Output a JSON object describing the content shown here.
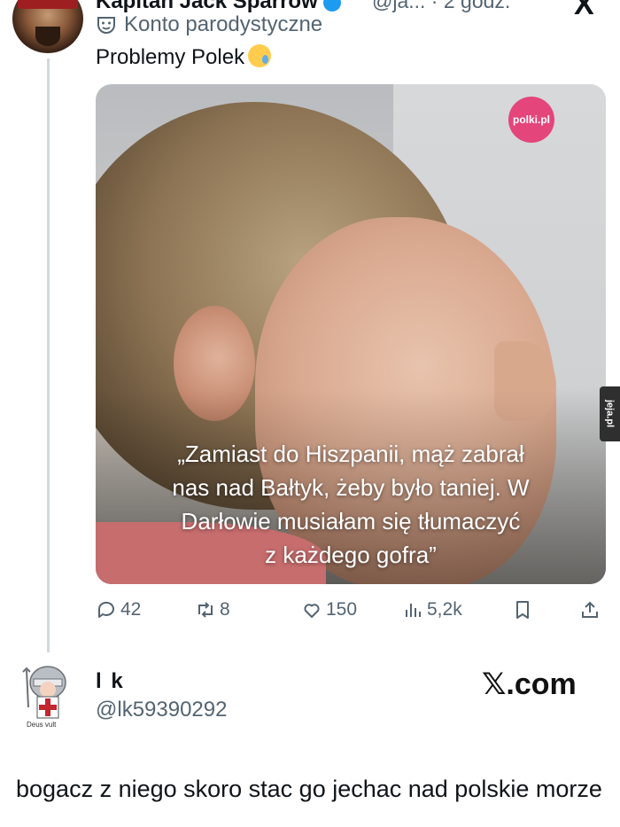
{
  "top_tweet": {
    "display_name": "Kapitan Jack Sparrow",
    "handle": "@ja... · 2 godz.",
    "account_label": "Konto parodystyczne",
    "text": "Problemy Polek"
  },
  "media": {
    "badge": "polki.pl",
    "quote_lines": [
      "„Zamiast do Hiszpanii, mąż zabrał",
      "nas nad Bałtyk, żeby było taniej. W",
      "Darłowie musiałam się tłumaczyć",
      "z każdego gofra”"
    ]
  },
  "actions": {
    "replies": "42",
    "reposts": "8",
    "likes": "150",
    "views": "5,2k"
  },
  "watermark": {
    "tab": "jeja.pl"
  },
  "reply": {
    "display_name": "l k",
    "handle": "@lk59390292",
    "avatar_caption": "Deus vult",
    "source": "𝕏.com",
    "text": "bogacz z niego skoro stac go jechac nad polskie morze"
  }
}
